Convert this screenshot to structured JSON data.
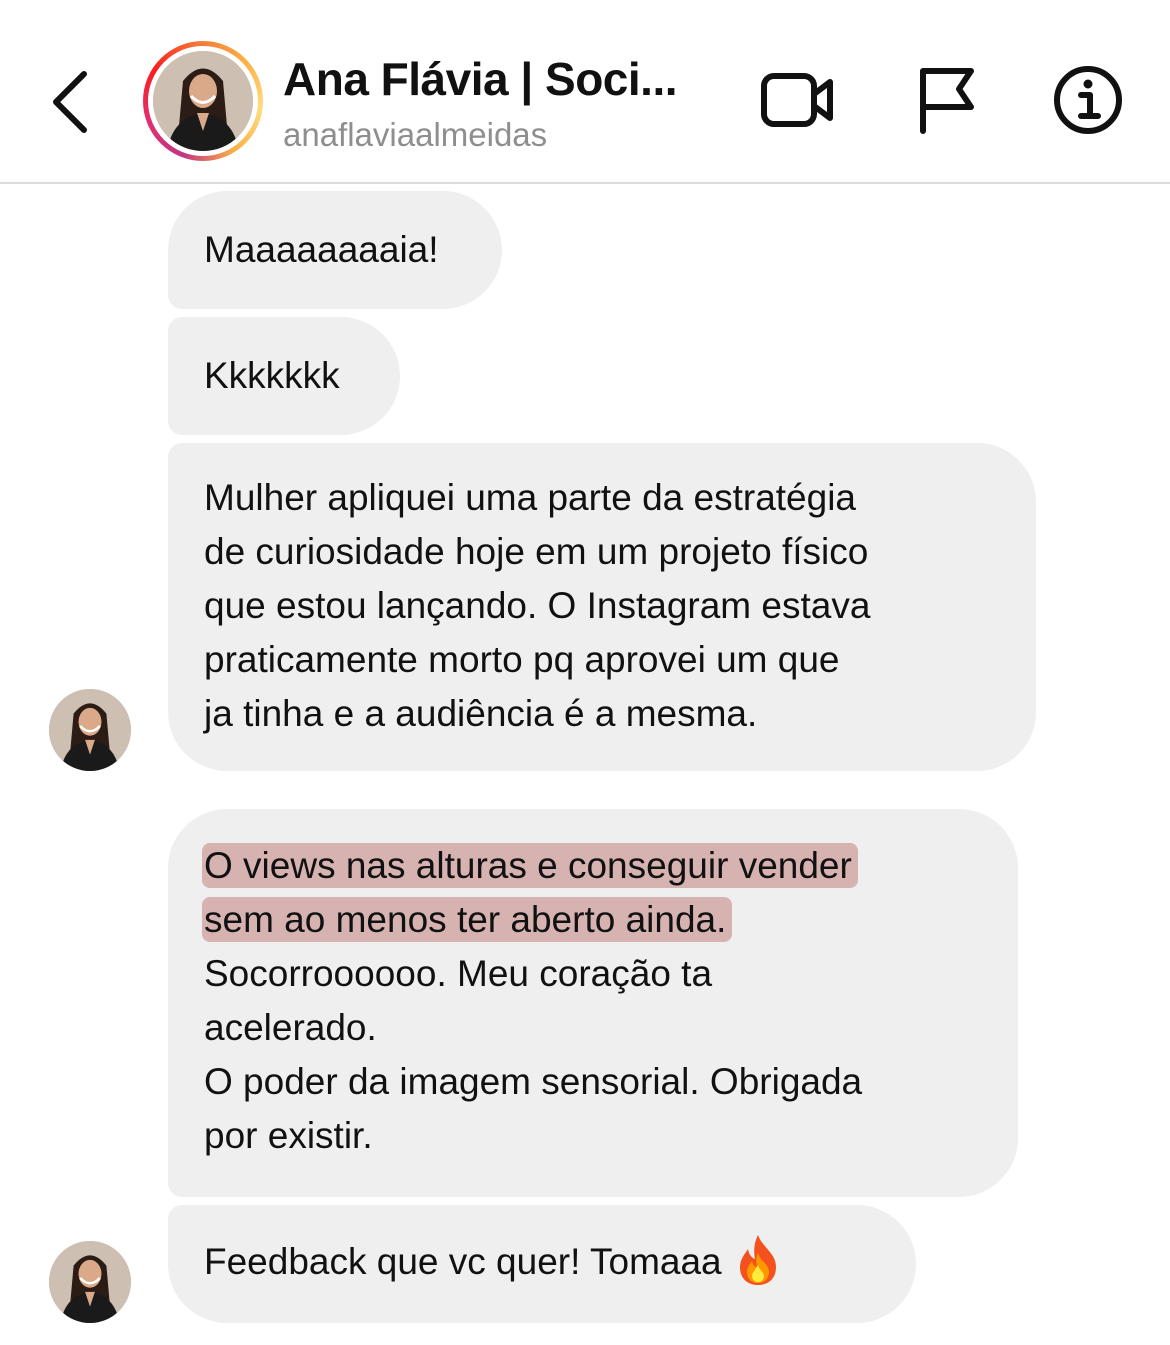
{
  "header": {
    "display_name": "Ana Flávia | Soci...",
    "username": "anaflaviaalmeidas",
    "icons": [
      "back-chevron-icon",
      "video-camera-icon",
      "flag-icon",
      "info-icon"
    ]
  },
  "messages": [
    {
      "lines": [
        "Maaaaaaaaia!"
      ]
    },
    {
      "lines": [
        "Kkkkkkk"
      ]
    },
    {
      "lines": [
        "Mulher apliquei uma parte da estratégia",
        "de curiosidade hoje em um projeto físico",
        "que estou lançando. O Instagram estava",
        "praticamente morto pq aprovei um que",
        "ja tinha e a audiência é a mesma."
      ]
    },
    {
      "highlighted_lines": [
        "O views nas alturas e conseguir vender",
        "sem ao menos ter aberto ainda."
      ],
      "lines": [
        "Socorroooooo. Meu coração ta",
        "acelerado.",
        "O poder da imagem sensorial. Obrigada",
        "por existir."
      ]
    },
    {
      "lines": [
        "Feedback que vc quer! Tomaaa"
      ],
      "emoji": "fire-icon"
    }
  ],
  "colors": {
    "bubble_bg": "#efefef",
    "highlight": "#d6b2b0",
    "username": "#8e8e8e",
    "divider": "#dcdcdc"
  }
}
